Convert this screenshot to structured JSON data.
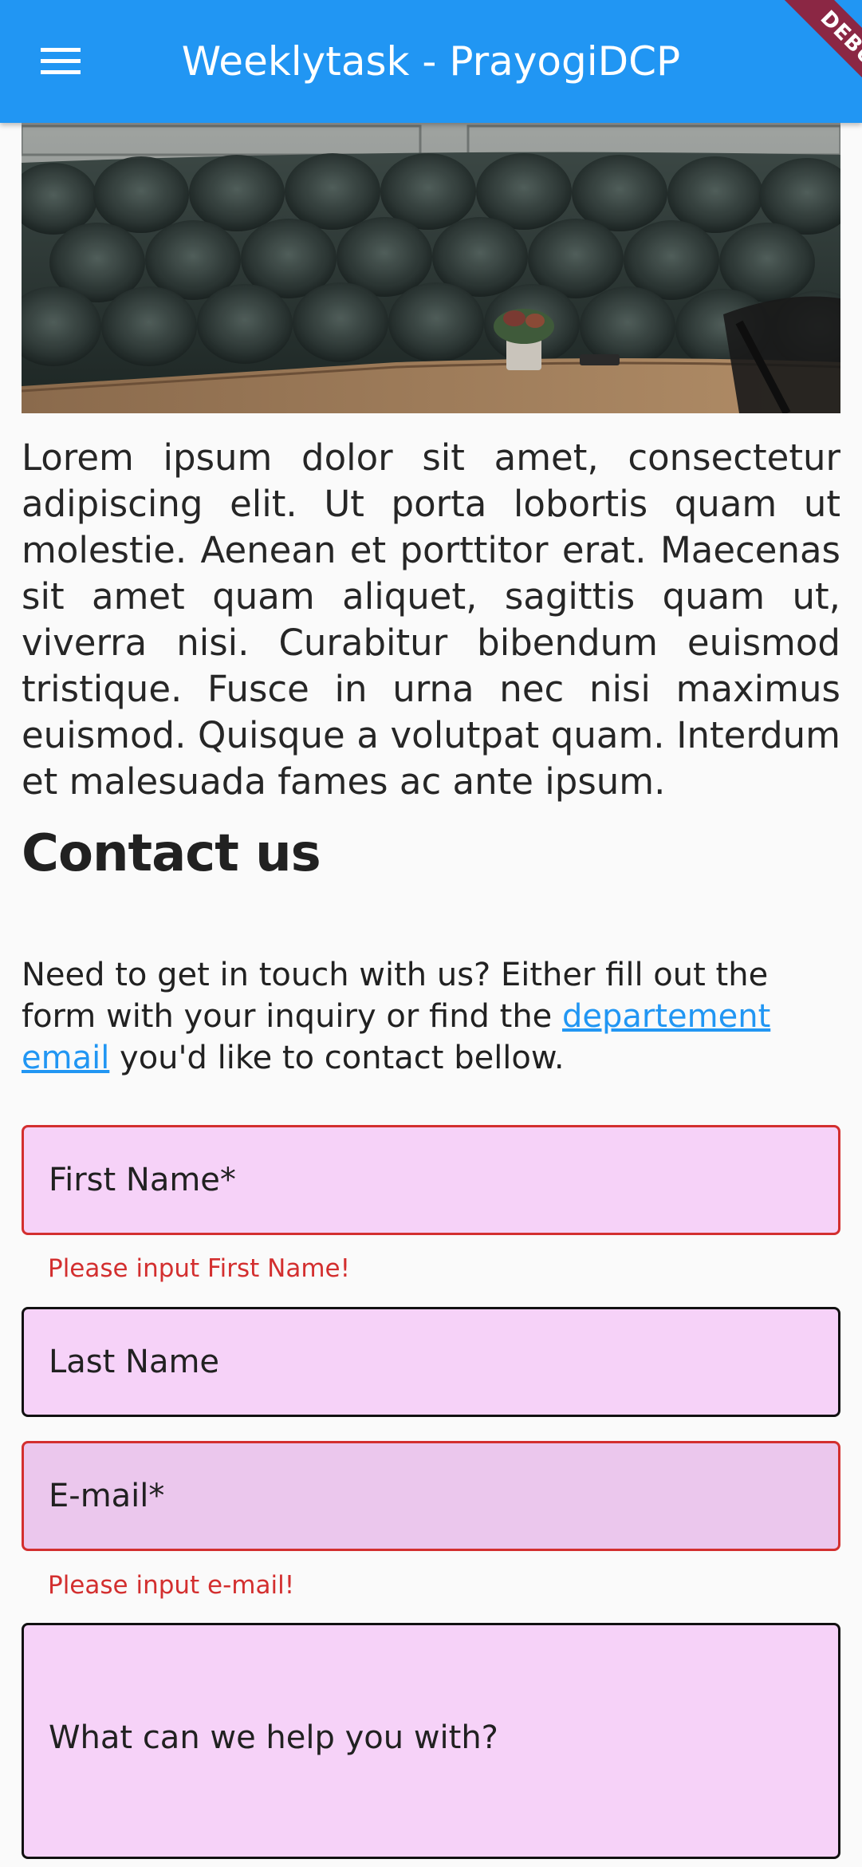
{
  "app_bar": {
    "title": "Weeklytask - PrayogiDCP",
    "debug_label": "DEBUG",
    "color": "#2196f3"
  },
  "hero_image": {
    "icon": "cafe-booth-photo"
  },
  "body_text": "Lorem ipsum dolor sit amet, consectetur adipiscing elit. Ut porta lobortis quam ut molestie. Aenean et porttitor erat. Maecenas sit amet quam aliquet, sagittis quam ut, viverra nisi. Curabitur bibendum euismod tristique. Fusce in urna nec nisi maximus euismod. Quisque a volutpat quam. Interdum et malesuada fames ac ante ipsum.",
  "contact": {
    "heading": "Contact us",
    "intro_before": "Need to get in touch with us? Either fill out the form with your inquiry or find the ",
    "intro_link": "departement email",
    "intro_after": " you'd like to contact bellow.",
    "link_color": "#2196f3"
  },
  "form": {
    "first_name": {
      "label": "First Name*",
      "error": "Please input First Name!"
    },
    "last_name": {
      "label": "Last Name"
    },
    "email": {
      "label": "E-mail*",
      "error": "Please input e-mail!"
    },
    "message": {
      "label": "What can we help you with?"
    },
    "field_fill": "#f6d2f8",
    "error_color": "#d32f2f"
  }
}
